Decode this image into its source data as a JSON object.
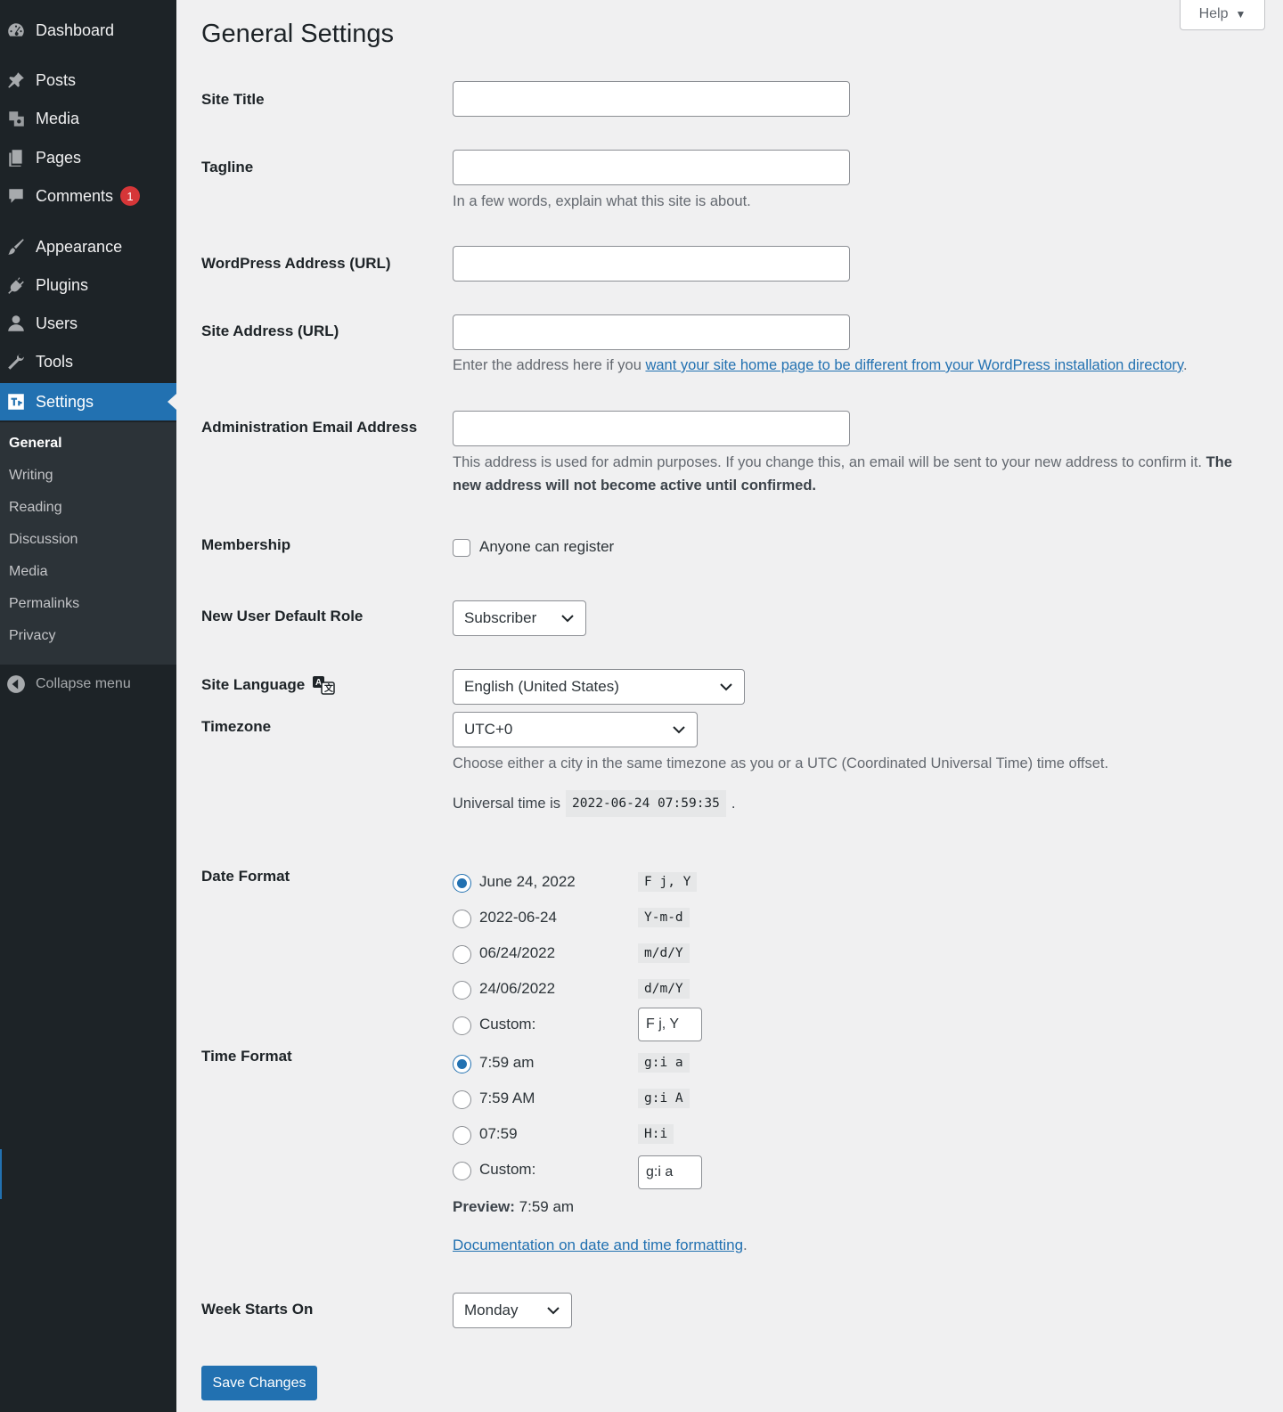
{
  "sidebar": {
    "items": [
      {
        "label": "Dashboard",
        "icon": "dashboard-icon"
      },
      {
        "label": "Posts",
        "icon": "pin-icon"
      },
      {
        "label": "Media",
        "icon": "media-icon"
      },
      {
        "label": "Pages",
        "icon": "pages-icon"
      },
      {
        "label": "Comments",
        "icon": "comment-icon",
        "badge": "1"
      },
      {
        "label": "Appearance",
        "icon": "brush-icon"
      },
      {
        "label": "Plugins",
        "icon": "plug-icon"
      },
      {
        "label": "Users",
        "icon": "user-icon"
      },
      {
        "label": "Tools",
        "icon": "wrench-icon"
      },
      {
        "label": "Settings",
        "icon": "settings-icon"
      }
    ],
    "submenu": [
      "General",
      "Writing",
      "Reading",
      "Discussion",
      "Media",
      "Permalinks",
      "Privacy"
    ],
    "collapse_label": "Collapse menu"
  },
  "help": {
    "label": "Help",
    "arrow": "▼"
  },
  "page": {
    "title": "General Settings"
  },
  "fields": {
    "site_title": {
      "label": "Site Title",
      "value": ""
    },
    "tagline": {
      "label": "Tagline",
      "value": "",
      "description": "In a few words, explain what this site is about."
    },
    "wp_address": {
      "label": "WordPress Address (URL)",
      "value": ""
    },
    "site_address": {
      "label": "Site Address (URL)",
      "value": "",
      "desc_prefix": "Enter the address here if you ",
      "desc_link": "want your site home page to be different from your WordPress installation directory",
      "desc_suffix": "."
    },
    "admin_email": {
      "label": "Administration Email Address",
      "value": "",
      "desc_text": "This address is used for admin purposes. If you change this, an email will be sent to your new address to confirm it. ",
      "desc_bold": "The new address will not become active until confirmed."
    },
    "membership": {
      "label": "Membership",
      "checkbox_label": "Anyone can register",
      "checked": false
    },
    "default_role": {
      "label": "New User Default Role",
      "value": "Subscriber"
    },
    "site_language": {
      "label": "Site Language",
      "value": "English (United States)"
    },
    "timezone": {
      "label": "Timezone",
      "value": "UTC+0",
      "description": "Choose either a city in the same timezone as you or a UTC (Coordinated Universal Time) time offset.",
      "universal_prefix": "Universal time is",
      "universal_time": "2022-06-24 07:59:35",
      "universal_suffix": "."
    },
    "date_format": {
      "label": "Date Format",
      "options": [
        {
          "label": "June 24, 2022",
          "code": "F j, Y",
          "checked": true
        },
        {
          "label": "2022-06-24",
          "code": "Y-m-d",
          "checked": false
        },
        {
          "label": "06/24/2022",
          "code": "m/d/Y",
          "checked": false
        },
        {
          "label": "24/06/2022",
          "code": "d/m/Y",
          "checked": false
        }
      ],
      "custom_label": "Custom:",
      "custom_value": "F j, Y"
    },
    "time_format": {
      "label": "Time Format",
      "options": [
        {
          "label": "7:59 am",
          "code": "g:i a",
          "checked": true
        },
        {
          "label": "7:59 AM",
          "code": "g:i A",
          "checked": false
        },
        {
          "label": "07:59",
          "code": "H:i",
          "checked": false
        }
      ],
      "custom_label": "Custom:",
      "custom_value": "g:i a",
      "preview_label": "Preview:",
      "preview_value": "7:59 am",
      "doc_link": "Documentation on date and time formatting",
      "doc_suffix": "."
    },
    "week_start": {
      "label": "Week Starts On",
      "value": "Monday"
    }
  },
  "save_label": "Save Changes",
  "colors": {
    "accent": "#2271b1",
    "sidebar": "#1d2327",
    "badge": "#d63638"
  }
}
